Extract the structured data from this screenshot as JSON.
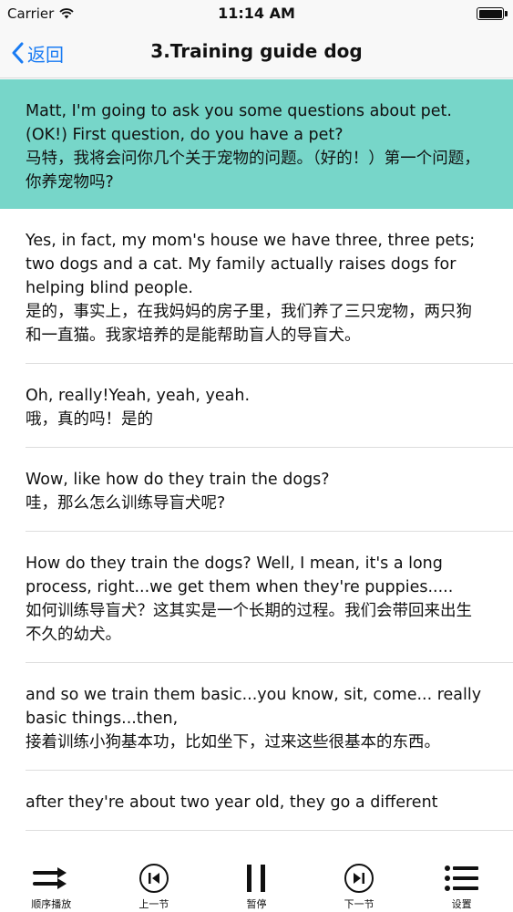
{
  "status_bar": {
    "carrier": "Carrier",
    "time": "11:14 AM"
  },
  "nav": {
    "back_label": "返回",
    "title": "3.Training guide dog"
  },
  "colors": {
    "accent": "#1a7cf3",
    "highlight": "#77d6c9"
  },
  "paragraphs": [
    {
      "en": "Matt, I'm going to ask you some questions about pet. (OK!) First question, do you have a pet?",
      "cn": "马特，我将会问你几个关于宠物的问题。（好的！）第一个问题，你养宠物吗?"
    },
    {
      "en": "Yes, in fact, my mom's house we have three, three pets; two dogs and a cat. My family actually raises dogs for helping blind people.",
      "cn": "是的，事实上，在我妈妈的房子里，我们养了三只宠物，两只狗和一直猫。我家培养的是能帮助盲人的导盲犬。"
    },
    {
      "en": "Oh, really!Yeah, yeah, yeah.",
      "cn": "哦，真的吗！是的"
    },
    {
      "en": "Wow, like how do they train the dogs?",
      "cn": "哇，那么怎么训练导盲犬呢?"
    },
    {
      "en": "How do they train the dogs? Well, I mean, it's a long process, right...we get them when they're puppies.....",
      "cn": "如何训练导盲犬？这其实是一个长期的过程。我们会带回来出生不久的幼犬。"
    },
    {
      "en": "and so we train them basic...you know, sit, come... really basic things...then,",
      "cn": "接着训练小狗基本功，比如坐下，过来这些很基本的东西。"
    },
    {
      "en": "after they're about two year old, they go a different",
      "cn": ""
    }
  ],
  "tabs": [
    {
      "label": "顺序播放",
      "icon": "shuffle-icon"
    },
    {
      "label": "上一节",
      "icon": "previous-icon"
    },
    {
      "label": "暂停",
      "icon": "pause-icon"
    },
    {
      "label": "下一节",
      "icon": "next-icon"
    },
    {
      "label": "设置",
      "icon": "settings-list-icon"
    }
  ]
}
